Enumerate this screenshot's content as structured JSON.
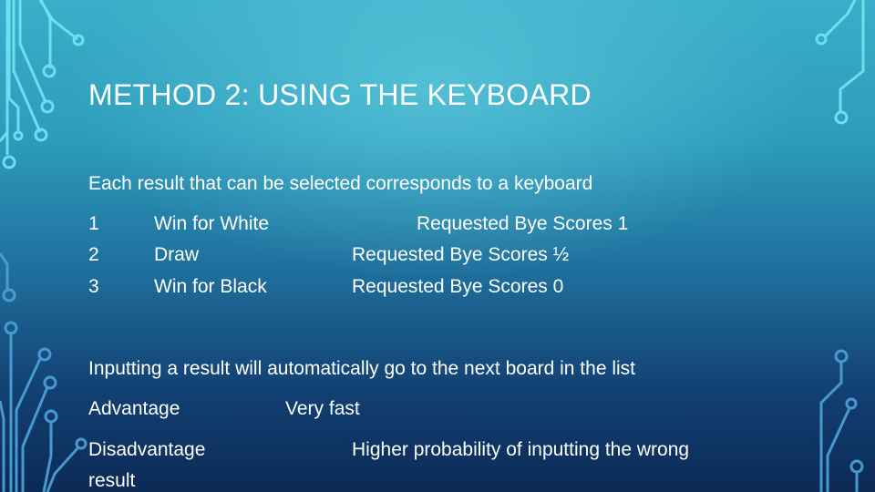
{
  "slide": {
    "title": "METHOD 2: USING THE KEYBOARD",
    "intro": "Each result that can be selected corresponds to a keyboard",
    "results": [
      {
        "key": "1",
        "label": "Win for White",
        "bye": "Requested Bye Scores 1"
      },
      {
        "key": "2",
        "label": "Draw",
        "bye": "Requested Bye Scores ½"
      },
      {
        "key": "3",
        "label": "Win for Black",
        "bye": "Requested Bye Scores 0"
      }
    ],
    "auto_note": "Inputting a result will automatically go to the next board in the list",
    "advantage": {
      "label": "Advantage",
      "value": "Very fast"
    },
    "disadvantage": {
      "label": "Disadvantage",
      "label_cont": "result",
      "value": "Higher probability of inputting the wrong"
    }
  },
  "theme": {
    "circuit_color": "#6fe3f2",
    "circuit_dark": "#4a9fd6"
  }
}
